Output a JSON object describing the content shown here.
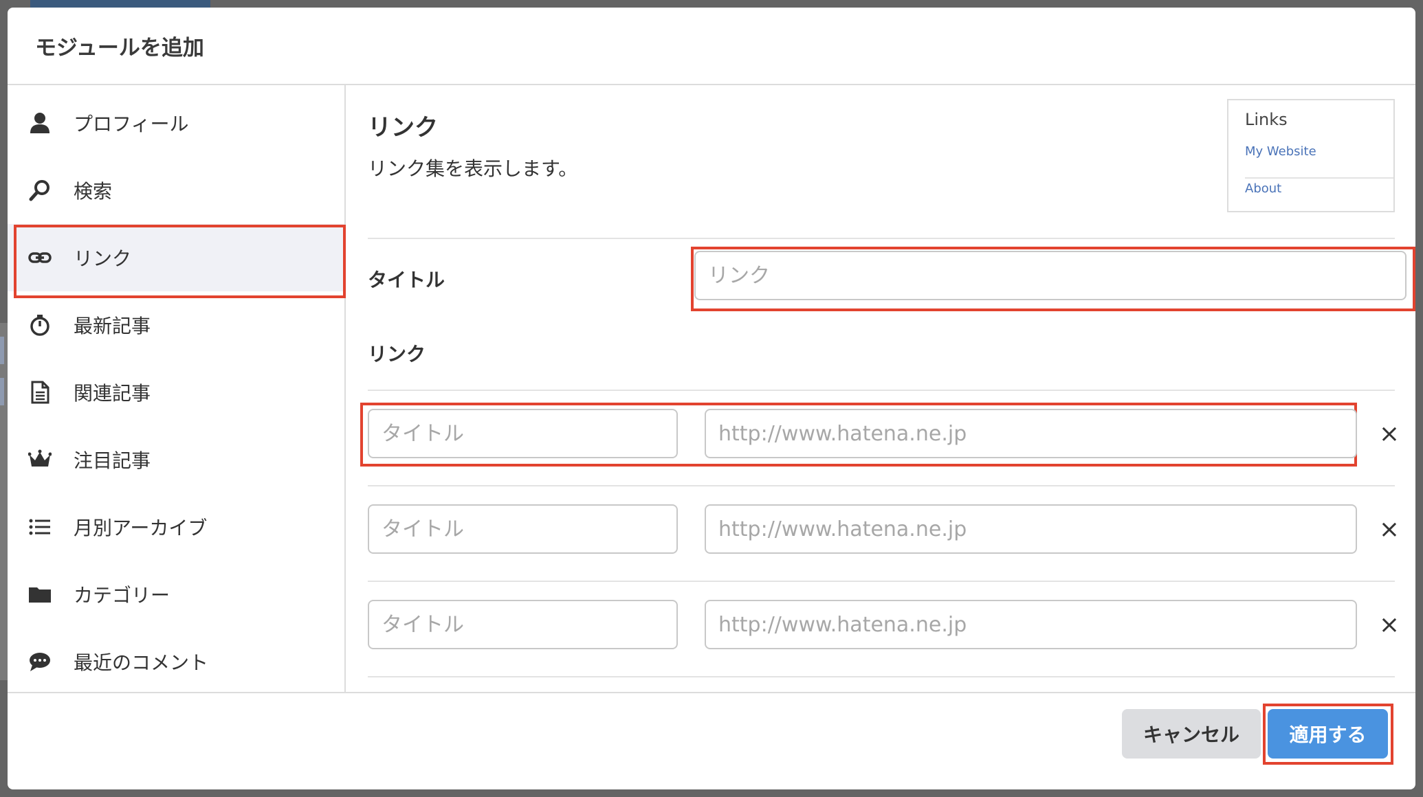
{
  "modal": {
    "title": "モジュールを追加"
  },
  "sidebar": {
    "items": [
      {
        "label": "プロフィール",
        "icon": "user-icon"
      },
      {
        "label": "検索",
        "icon": "search-icon"
      },
      {
        "label": "リンク",
        "icon": "link-icon",
        "active": true
      },
      {
        "label": "最新記事",
        "icon": "stopwatch-icon"
      },
      {
        "label": "関連記事",
        "icon": "document-icon"
      },
      {
        "label": "注目記事",
        "icon": "crown-icon"
      },
      {
        "label": "月別アーカイブ",
        "icon": "list-icon"
      },
      {
        "label": "カテゴリー",
        "icon": "folder-icon"
      },
      {
        "label": "最近のコメント",
        "icon": "comment-icon"
      }
    ]
  },
  "content": {
    "title": "リンク",
    "description": "リンク集を表示します。",
    "preview": {
      "title": "Links",
      "links": [
        "My Website",
        "About"
      ]
    },
    "title_field": {
      "label": "タイトル",
      "placeholder": "リンク"
    },
    "links_section": {
      "label": "リンク",
      "rows": [
        {
          "title_placeholder": "タイトル",
          "url_placeholder": "http://www.hatena.ne.jp",
          "remove": "×"
        },
        {
          "title_placeholder": "タイトル",
          "url_placeholder": "http://www.hatena.ne.jp",
          "remove": "×"
        },
        {
          "title_placeholder": "タイトル",
          "url_placeholder": "http://www.hatena.ne.jp",
          "remove": "×"
        }
      ]
    }
  },
  "footer": {
    "cancel_label": "キャンセル",
    "apply_label": "適用する"
  },
  "colors": {
    "highlight": "#e2432f",
    "apply_button": "#4a93e0",
    "cancel_button": "#dcdde0",
    "preview_link": "#4a73b8"
  }
}
